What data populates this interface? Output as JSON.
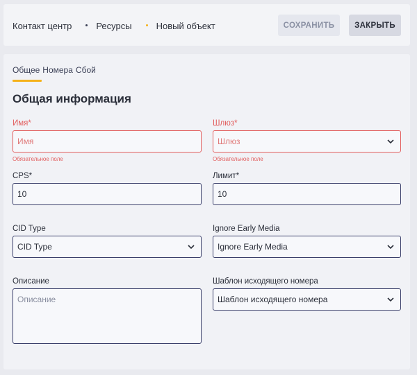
{
  "breadcrumb": {
    "items": [
      "Контакт центр",
      "Ресурсы",
      "Новый объект"
    ]
  },
  "toolbar": {
    "save_label": "СОХРАНИТЬ",
    "close_label": "ЗАКРЫТЬ"
  },
  "tabs": [
    {
      "label": "Общее",
      "active": true
    },
    {
      "label": "Номера",
      "active": false
    },
    {
      "label": "Сбой",
      "active": false
    }
  ],
  "section_title": "Общая информация",
  "form": {
    "name": {
      "label": "Имя*",
      "placeholder": "Имя",
      "error": "Обязательное поле"
    },
    "gateway": {
      "label": "Шлюз*",
      "placeholder": "Шлюз",
      "error": "Обязательное поле"
    },
    "cps": {
      "label": "CPS*",
      "value": "10"
    },
    "limit": {
      "label": "Лимит*",
      "value": "10"
    },
    "cid_type": {
      "label": "CID Type",
      "value": "CID Type"
    },
    "ignore_early_media": {
      "label": "Ignore Early Media",
      "value": "Ignore Early Media"
    },
    "description": {
      "label": "Описание",
      "placeholder": "Описание"
    },
    "template": {
      "label": "Шаблон исходящего номера",
      "value": "Шаблон исходящего номера"
    }
  },
  "colors": {
    "accent": "#f5b21b",
    "error": "#e25c5c",
    "border": "#3a3f6a",
    "background": "#e9eaef"
  }
}
